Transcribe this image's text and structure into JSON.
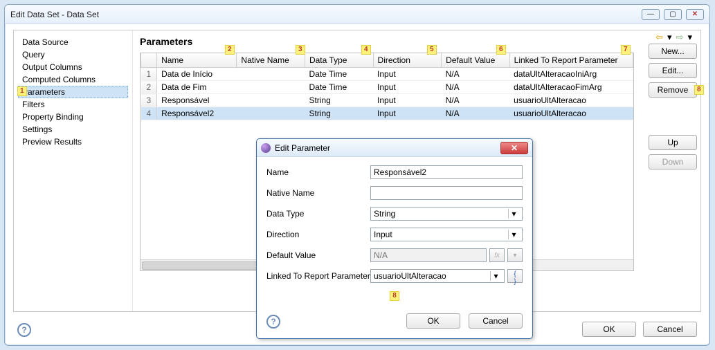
{
  "window": {
    "title": "Edit Data Set - Data Set"
  },
  "sidebar": {
    "items": [
      "Data Source",
      "Query",
      "Output Columns",
      "Computed Columns",
      "Parameters",
      "Filters",
      "Property Binding",
      "Settings",
      "Preview Results"
    ],
    "selected_index": 4
  },
  "heading": "Parameters",
  "columns": {
    "name": "Name",
    "native": "Native Name",
    "dtype": "Data Type",
    "direction": "Direction",
    "default": "Default Value",
    "linked": "Linked To Report Parameter"
  },
  "rows": [
    {
      "n": "1",
      "name": "Data de Início",
      "native": "",
      "dtype": "Date Time",
      "dir": "Input",
      "def": "N/A",
      "link": "dataUltAlteracaoIniArg"
    },
    {
      "n": "2",
      "name": "Data de Fim",
      "native": "",
      "dtype": "Date Time",
      "dir": "Input",
      "def": "N/A",
      "link": "dataUltAlteracaoFimArg"
    },
    {
      "n": "3",
      "name": "Responsável",
      "native": "",
      "dtype": "String",
      "dir": "Input",
      "def": "N/A",
      "link": "usuarioUltAlteracao"
    },
    {
      "n": "4",
      "name": "Responsável2",
      "native": "",
      "dtype": "String",
      "dir": "Input",
      "def": "N/A",
      "link": "usuarioUltAlteracao"
    }
  ],
  "selected_row_index": 3,
  "buttons": {
    "new": "New...",
    "edit": "Edit...",
    "remove": "Remove",
    "up": "Up",
    "down": "Down",
    "ok": "OK",
    "cancel": "Cancel"
  },
  "annotations": {
    "a1": "1",
    "a2": "2",
    "a3": "3",
    "a4": "4",
    "a5": "5",
    "a6": "6",
    "a7": "7",
    "a8": "8",
    "a8b": "8"
  },
  "dialog": {
    "title": "Edit Parameter",
    "labels": {
      "name": "Name",
      "native": "Native Name",
      "dtype": "Data Type",
      "direction": "Direction",
      "default": "Default Value",
      "linked": "Linked To Report Parameter"
    },
    "values": {
      "name": "Responsável2",
      "native": "",
      "dtype": "String",
      "direction": "Input",
      "default_placeholder": "N/A",
      "linked": "usuarioUltAlteracao"
    },
    "fx": "fx",
    "curly": "{ }",
    "ok": "OK",
    "cancel": "Cancel"
  }
}
